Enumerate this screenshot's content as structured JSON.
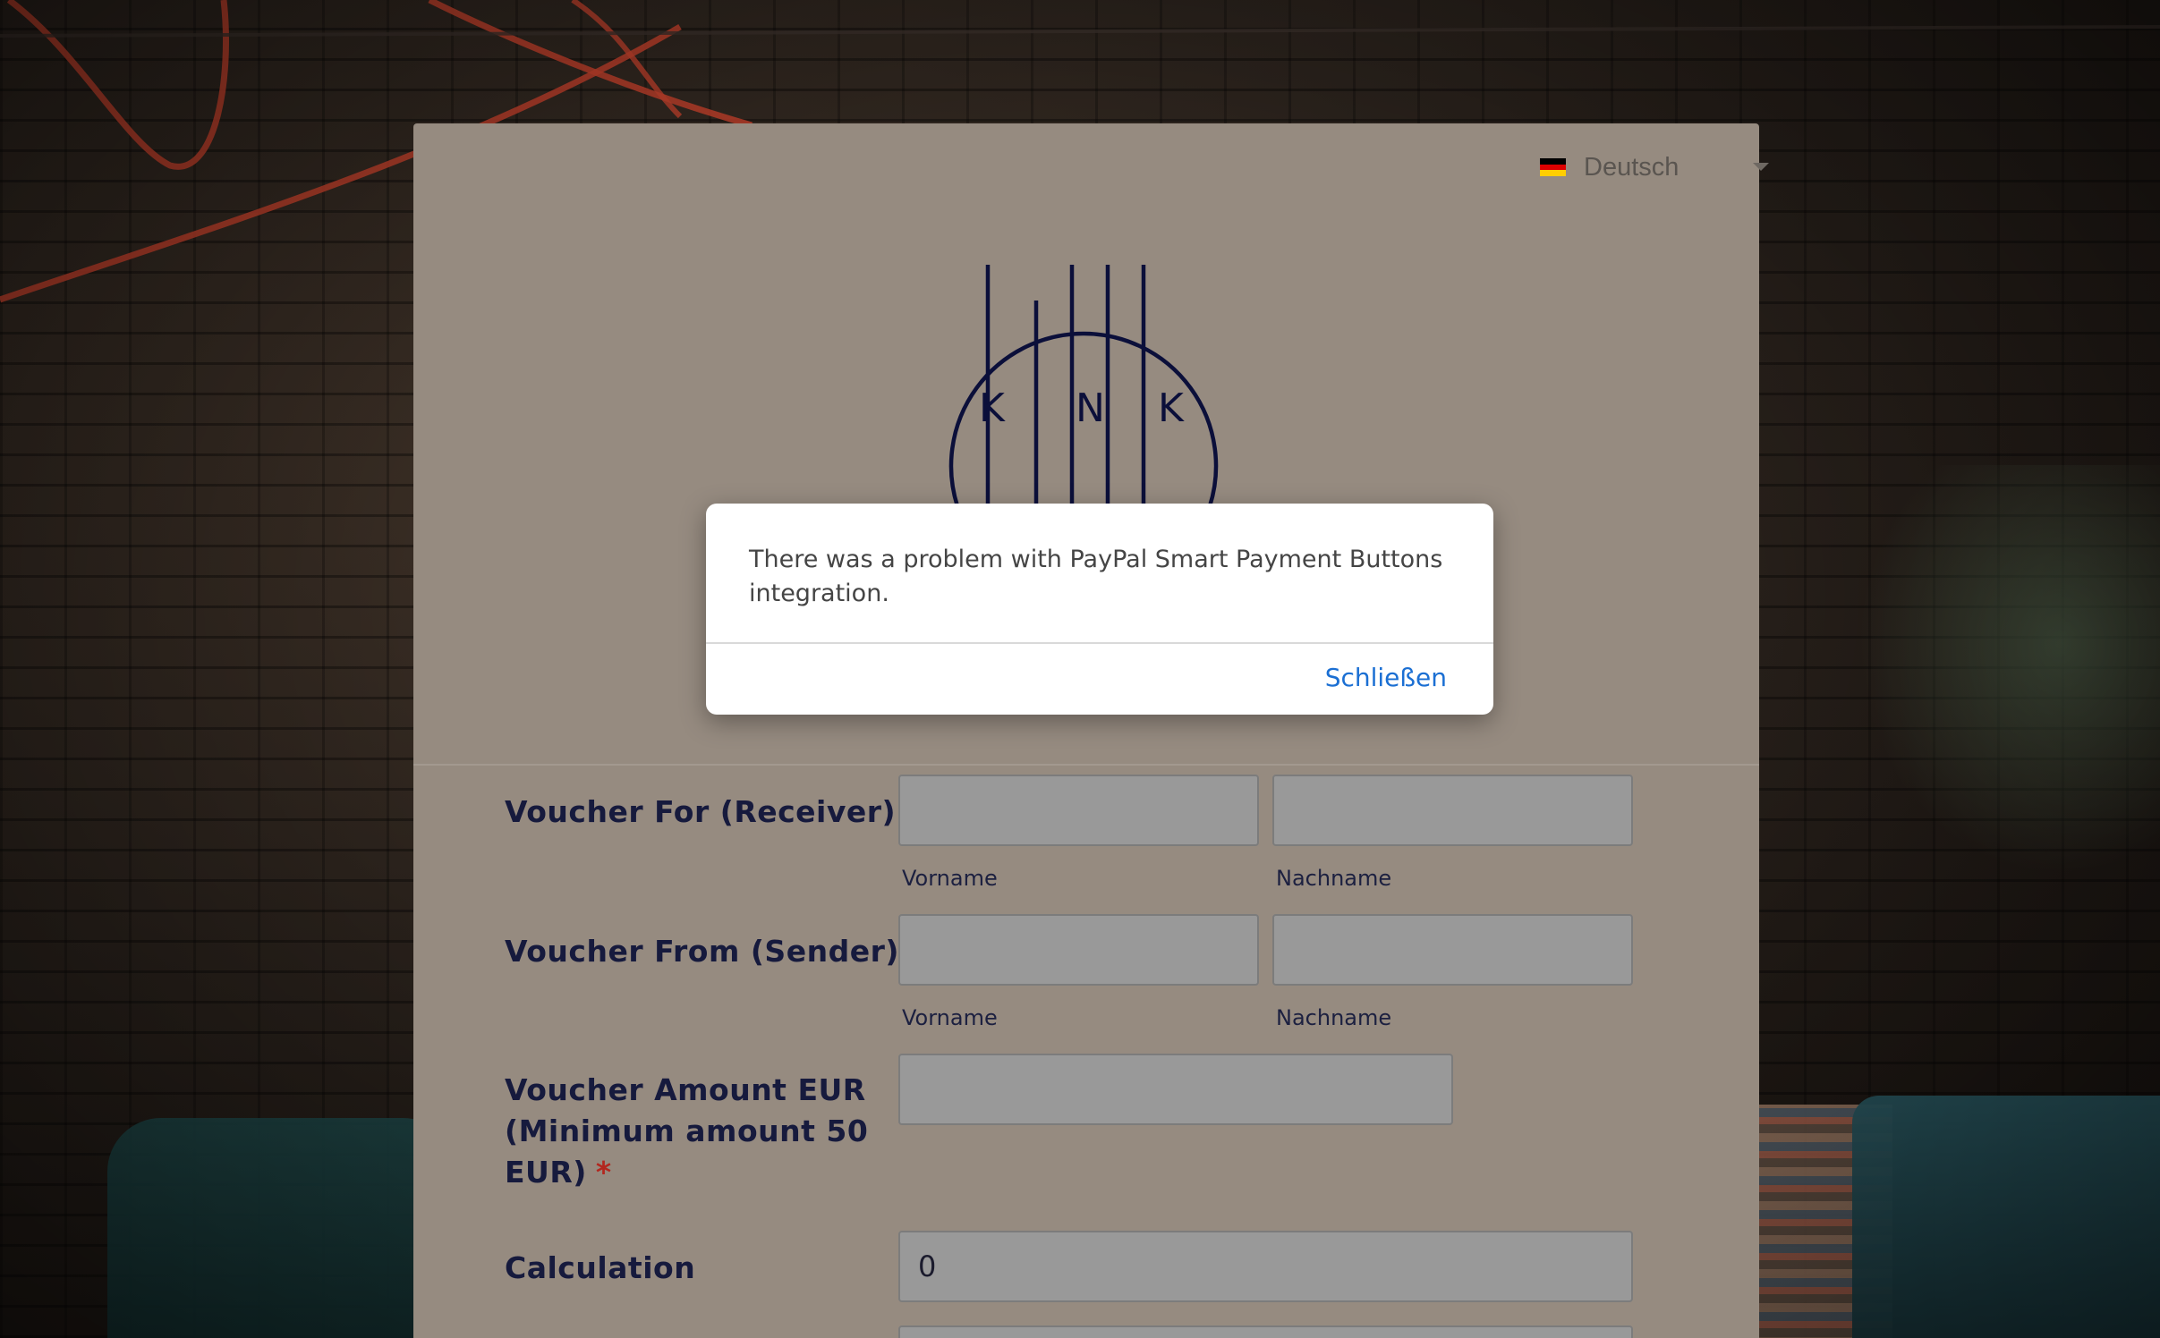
{
  "language_selector": {
    "label": "Deutsch",
    "flag_colors": [
      "#000000",
      "#dd0000",
      "#ffce00"
    ]
  },
  "logo": {
    "letters": [
      "K",
      "I",
      "N",
      "K"
    ],
    "color": "#0b0f3a"
  },
  "form": {
    "fields": [
      {
        "label": "Voucher For (Receiver)",
        "sublabels": [
          "Vorname",
          "Nachname"
        ]
      },
      {
        "label": "Voucher From (Sender)",
        "sublabels": [
          "Vorname",
          "Nachname"
        ]
      },
      {
        "label_lines": [
          "Voucher Amount EUR",
          "(Minimum amount 50",
          "EUR)"
        ],
        "required_marker": "*"
      },
      {
        "label": "Calculation",
        "value": "0"
      }
    ]
  },
  "modal": {
    "message": "There was a problem with PayPal Smart Payment Buttons integration.",
    "close_label": "Schließen"
  },
  "colors": {
    "card_bg": "#968b80",
    "input_bg": "#999999",
    "label_text": "#161a3d",
    "link_blue": "#1b6fd3",
    "required_red": "#b3261e"
  }
}
